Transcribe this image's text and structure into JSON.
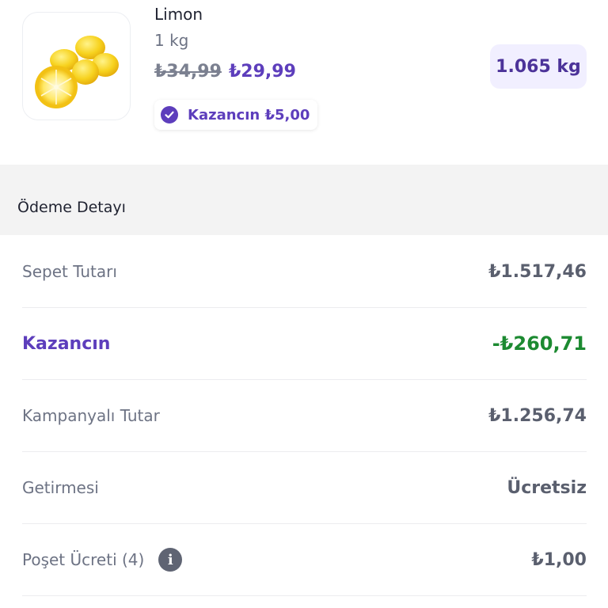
{
  "product": {
    "name": "Limon",
    "unit": "1 kg",
    "old_price": "₺34,99",
    "new_price": "₺29,99",
    "savings_label": "Kazancın ₺5,00",
    "quantity": "1.065 kg"
  },
  "payment": {
    "title": "Ödeme Detayı",
    "rows": [
      {
        "label": "Sepet Tutarı",
        "value": "₺1.517,46"
      },
      {
        "label": "Kazancın",
        "value": "-₺260,71"
      },
      {
        "label": "Kampanyalı Tutar",
        "value": "₺1.256,74"
      },
      {
        "label": "Getirmesi",
        "value": "Ücretsiz"
      },
      {
        "label": "Poşet Ücreti (4)",
        "value": "₺1,00"
      }
    ]
  },
  "colors": {
    "brand_purple": "#5d3ebc",
    "savings_green": "#1c8a31",
    "badge_bg": "#f1efff"
  },
  "icons": {
    "check": "check-circle-icon",
    "info": "info-icon"
  }
}
